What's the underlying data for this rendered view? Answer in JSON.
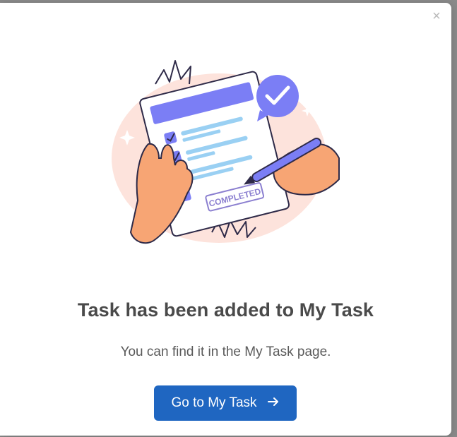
{
  "modal": {
    "close_symbol": "×",
    "title": "Task has been added to My Task",
    "message": "You can find it in the My Task page.",
    "button_label": "Go to My Task",
    "button_icon": "arrow-right-icon",
    "illustration_stamp": "COMPLETED"
  },
  "colors": {
    "button_bg": "#1f66c1",
    "title": "#4a4a4a",
    "accent_purple": "#7b7ef5",
    "blob_pink": "#fde3dc",
    "skin": "#f7a574"
  }
}
